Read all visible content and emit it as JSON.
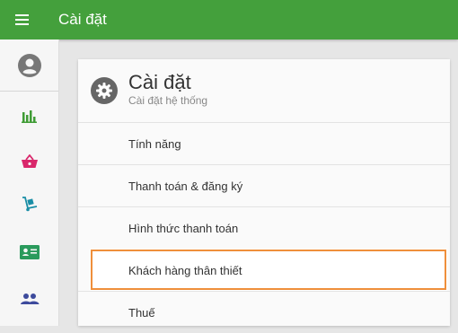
{
  "topbar": {
    "title": "Cài đặt",
    "menu_icon": "menu-icon",
    "color": "#44a03c"
  },
  "rail": {
    "items": [
      {
        "name": "account",
        "icon": "account-circle-icon"
      },
      {
        "name": "reports",
        "icon": "bar-chart-icon"
      },
      {
        "name": "sales",
        "icon": "basket-icon"
      },
      {
        "name": "delivery",
        "icon": "hand-truck-icon"
      },
      {
        "name": "customers",
        "icon": "contact-card-icon"
      },
      {
        "name": "staff",
        "icon": "people-icon"
      }
    ]
  },
  "card": {
    "title": "Cài đặt",
    "subtitle": "Cài đặt hệ thống",
    "icon": "gear-icon",
    "items": [
      {
        "label": "Tính năng"
      },
      {
        "label": "Thanh toán & đăng ký"
      },
      {
        "label": "Hình thức thanh toán"
      },
      {
        "label": "Khách hàng thân thiết",
        "selected": true
      },
      {
        "label": "Thuế"
      }
    ]
  },
  "colors": {
    "highlight": "#ef8f3b",
    "accent": "#44a03c"
  }
}
